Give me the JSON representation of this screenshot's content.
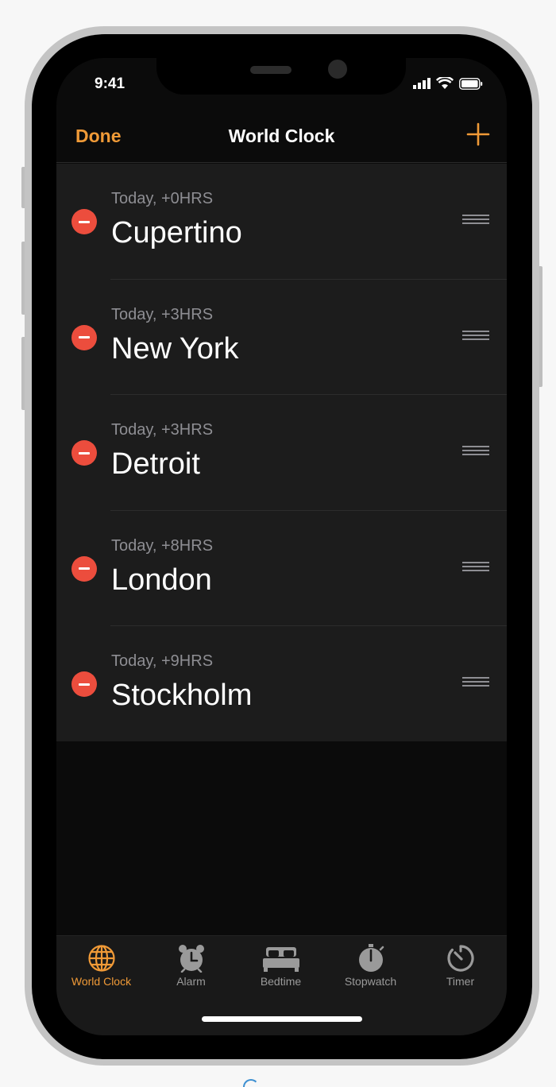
{
  "status_bar": {
    "time": "9:41"
  },
  "nav": {
    "done_label": "Done",
    "title": "World Clock",
    "add_icon": "plus-icon"
  },
  "clocks": [
    {
      "offset": "Today, +0HRS",
      "city": "Cupertino"
    },
    {
      "offset": "Today, +3HRS",
      "city": "New York"
    },
    {
      "offset": "Today, +3HRS",
      "city": "Detroit"
    },
    {
      "offset": "Today, +8HRS",
      "city": "London"
    },
    {
      "offset": "Today, +9HRS",
      "city": "Stockholm"
    }
  ],
  "tabs": [
    {
      "label": "World Clock",
      "icon": "globe-icon",
      "active": true
    },
    {
      "label": "Alarm",
      "icon": "alarm-clock-icon",
      "active": false
    },
    {
      "label": "Bedtime",
      "icon": "bed-icon",
      "active": false
    },
    {
      "label": "Stopwatch",
      "icon": "stopwatch-icon",
      "active": false
    },
    {
      "label": "Timer",
      "icon": "timer-icon",
      "active": false
    }
  ],
  "colors": {
    "accent": "#f09a37",
    "delete": "#ec4d3d",
    "background": "#1c1c1c"
  }
}
